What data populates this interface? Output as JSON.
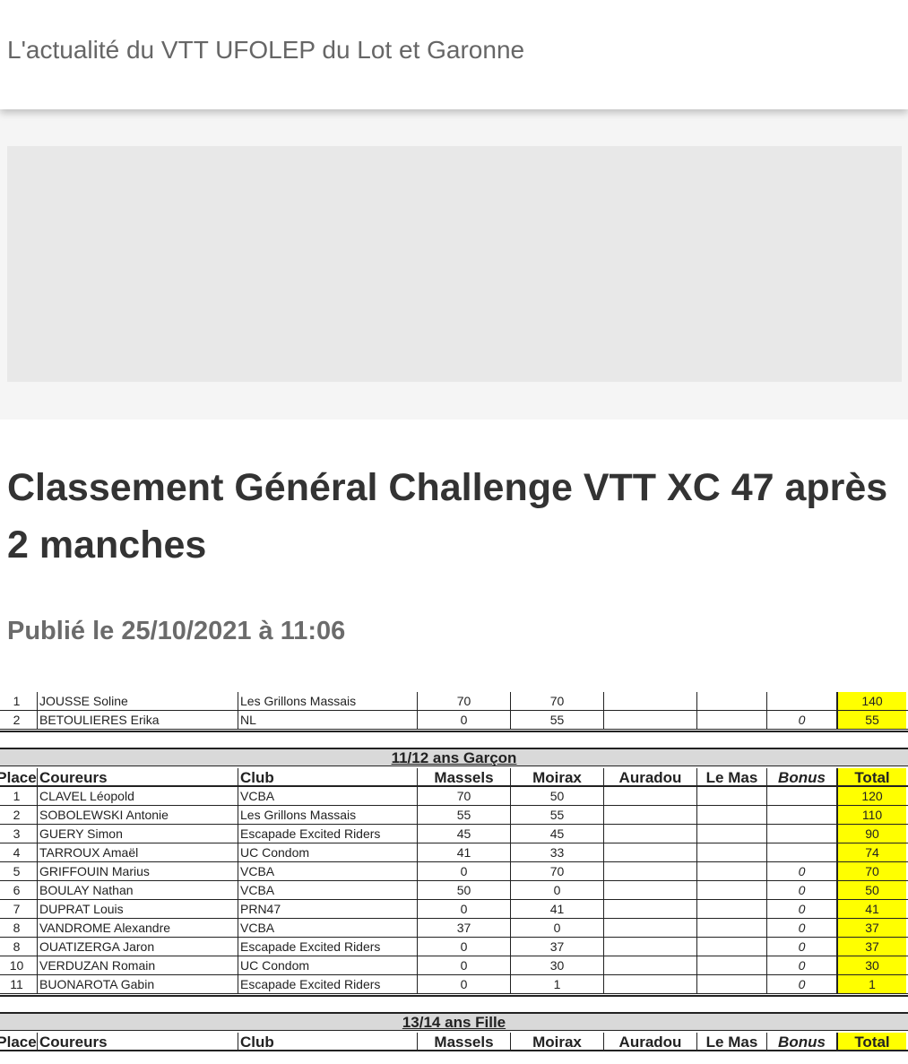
{
  "header": {
    "tagline": "L'actualité du VTT UFOLEP du Lot et Garonne"
  },
  "post": {
    "title": "Classement Général Challenge VTT XC 47 après 2 manches",
    "date": "Publié le 25/10/2021 à 11:06"
  },
  "ranking": {
    "columns": [
      "Place",
      "Coureurs",
      "Club",
      "Massels",
      "Moirax",
      "Auradou",
      "Le Mas",
      "Bonus",
      "Total"
    ],
    "highlight_color": "#ffff00",
    "prev_rows": [
      [
        "1",
        "JOUSSE Soline",
        "Les Grillons Massais",
        "70",
        "70",
        "",
        "",
        "",
        "140"
      ],
      [
        "2",
        "BETOULIERES Erika",
        "NL",
        "0",
        "55",
        "",
        "",
        "0",
        "55"
      ]
    ],
    "categories": [
      {
        "name": "11/12 ans Garçon",
        "rows": [
          [
            "1",
            "CLAVEL Léopold",
            "VCBA",
            "70",
            "50",
            "",
            "",
            "",
            "120"
          ],
          [
            "2",
            "SOBOLEWSKI Antonie",
            "Les Grillons Massais",
            "55",
            "55",
            "",
            "",
            "",
            "110"
          ],
          [
            "3",
            "GUERY Simon",
            "Escapade Excited Riders",
            "45",
            "45",
            "",
            "",
            "",
            "90"
          ],
          [
            "4",
            "TARROUX Amaël",
            "UC Condom",
            "41",
            "33",
            "",
            "",
            "",
            "74"
          ],
          [
            "5",
            "GRIFFOUIN Marius",
            "VCBA",
            "0",
            "70",
            "",
            "",
            "0",
            "70"
          ],
          [
            "6",
            "BOULAY Nathan",
            "VCBA",
            "50",
            "0",
            "",
            "",
            "0",
            "50"
          ],
          [
            "7",
            "DUPRAT Louis",
            "PRN47",
            "0",
            "41",
            "",
            "",
            "0",
            "41"
          ],
          [
            "8",
            "VANDROME Alexandre",
            "VCBA",
            "37",
            "0",
            "",
            "",
            "0",
            "37"
          ],
          [
            "8",
            "OUATIZERGA Jaron",
            "Escapade Excited Riders",
            "0",
            "37",
            "",
            "",
            "0",
            "37"
          ],
          [
            "10",
            "VERDUZAN Romain",
            "UC Condom",
            "0",
            "30",
            "",
            "",
            "0",
            "30"
          ],
          [
            "11",
            "BUONAROTA Gabin",
            "Escapade Excited Riders",
            "0",
            "1",
            "",
            "",
            "0",
            "1"
          ]
        ]
      },
      {
        "name": "13/14 ans Fille",
        "rows": []
      }
    ]
  }
}
